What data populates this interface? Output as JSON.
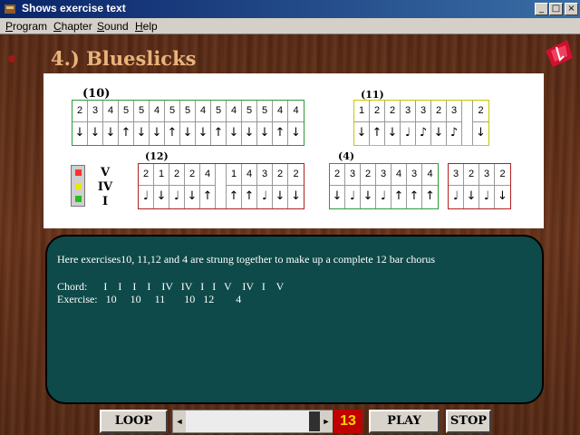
{
  "window": {
    "title": "Shows exercise text",
    "buttons": [
      "_",
      "□",
      "×"
    ]
  },
  "menu": [
    "Program",
    "Chapter",
    "Sound",
    "Help"
  ],
  "heading": "4.) Blueslicks",
  "colors": {
    "green": "#2b9a3a",
    "yellow": "#c8c800",
    "red": "#b02020",
    "panel_bg": "#ffffff",
    "text_panel": "#0e4a49"
  },
  "exercises": [
    {
      "label": "(10)",
      "color": "green",
      "cells": [
        [
          "2",
          "↓"
        ],
        [
          "3",
          "↓"
        ],
        [
          "4",
          "↓"
        ],
        [
          "5",
          "↑"
        ],
        [
          "5",
          "↓"
        ],
        [
          "4",
          "↓"
        ],
        [
          "5",
          "↑"
        ],
        [
          "5",
          "↓"
        ],
        [
          "4",
          "↓"
        ],
        [
          "5",
          "↑"
        ],
        [
          "4",
          "↓"
        ],
        [
          "5",
          "↓"
        ],
        [
          "5",
          "↓"
        ],
        [
          "4",
          "↑"
        ],
        [
          "4",
          "↓"
        ]
      ]
    },
    {
      "label": "(11)",
      "color": "yellow",
      "cells": [
        [
          "1",
          "↓"
        ],
        [
          "2",
          "↑"
        ],
        [
          "2",
          "↓"
        ],
        [
          "3",
          "♩"
        ],
        [
          "3",
          "♪"
        ],
        [
          "2",
          "↓"
        ],
        [
          "3",
          "♪"
        ],
        [
          "gap",
          ""
        ],
        [
          "2",
          "↓"
        ]
      ]
    },
    {
      "label": "(12)",
      "color": "red",
      "cells": [
        [
          "2",
          "♩"
        ],
        [
          "1",
          "↓"
        ],
        [
          "2",
          "♩"
        ],
        [
          "2",
          "↓"
        ],
        [
          "4",
          "↑"
        ],
        [
          "gap",
          ""
        ],
        [
          "1",
          "↑"
        ],
        [
          "4",
          "↑"
        ],
        [
          "3",
          "♩"
        ],
        [
          "2",
          "↓"
        ],
        [
          "2",
          "↓"
        ]
      ]
    },
    {
      "label": "(4)",
      "color": "green",
      "cells": [
        [
          "2",
          "↓"
        ],
        [
          "3",
          "♩"
        ],
        [
          "2",
          "↓"
        ],
        [
          "3",
          "♩"
        ],
        [
          "4",
          "↑"
        ],
        [
          "3",
          "↑"
        ],
        [
          "4",
          "↑"
        ]
      ]
    },
    {
      "label": "",
      "color": "red",
      "cells": [
        [
          "3",
          "♩"
        ],
        [
          "2",
          "↓"
        ],
        [
          "3",
          "♩"
        ],
        [
          "2",
          "↓"
        ]
      ]
    }
  ],
  "chord_labels": [
    "V",
    "IV",
    "I"
  ],
  "light_colors": [
    "#ff3030",
    "#e8e800",
    "#20c020"
  ],
  "text": {
    "line1": "Here exercises10, 11,12 and 4 are strung together to make up a complete 12 bar chorus",
    "chord": "Chord:      I    I    I    I    IV   IV   I   I   V    IV   I    V",
    "exercise": "Exercise:   10     10     11       10   12        4"
  },
  "controls": {
    "loop": "LOOP",
    "play": "PLAY",
    "stop": "STOP",
    "counter": "13",
    "scroll_left": "◄",
    "scroll_right": "►"
  }
}
